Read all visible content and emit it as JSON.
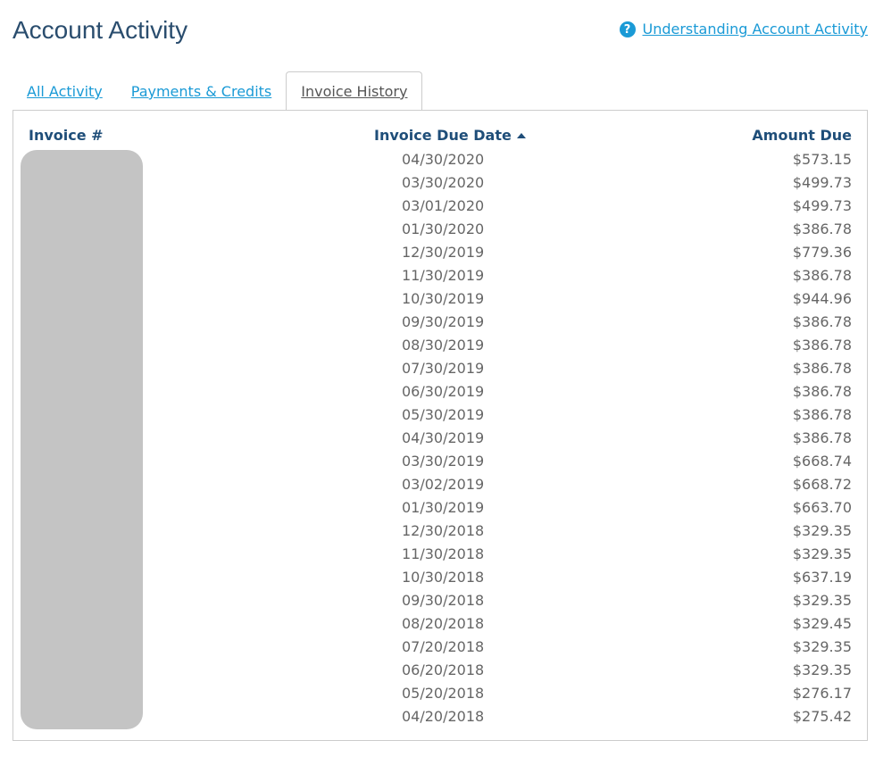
{
  "page": {
    "title": "Account Activity",
    "help_link": "Understanding Account Activity"
  },
  "tabs": [
    {
      "label": "All Activity",
      "active": false
    },
    {
      "label": "Payments & Credits",
      "active": false
    },
    {
      "label": "Invoice History",
      "active": true
    }
  ],
  "table": {
    "headers": {
      "invoice": "Invoice #",
      "due_date": "Invoice Due Date",
      "amount": "Amount Due"
    },
    "rows": [
      {
        "due_date": "04/30/2020",
        "amount": "$573.15"
      },
      {
        "due_date": "03/30/2020",
        "amount": "$499.73"
      },
      {
        "due_date": "03/01/2020",
        "amount": "$499.73"
      },
      {
        "due_date": "01/30/2020",
        "amount": "$386.78"
      },
      {
        "due_date": "12/30/2019",
        "amount": "$779.36"
      },
      {
        "due_date": "11/30/2019",
        "amount": "$386.78"
      },
      {
        "due_date": "10/30/2019",
        "amount": "$944.96"
      },
      {
        "due_date": "09/30/2019",
        "amount": "$386.78"
      },
      {
        "due_date": "08/30/2019",
        "amount": "$386.78"
      },
      {
        "due_date": "07/30/2019",
        "amount": "$386.78"
      },
      {
        "due_date": "06/30/2019",
        "amount": "$386.78"
      },
      {
        "due_date": "05/30/2019",
        "amount": "$386.78"
      },
      {
        "due_date": "04/30/2019",
        "amount": "$386.78"
      },
      {
        "due_date": "03/30/2019",
        "amount": "$668.74"
      },
      {
        "due_date": "03/02/2019",
        "amount": "$668.72"
      },
      {
        "due_date": "01/30/2019",
        "amount": "$663.70"
      },
      {
        "due_date": "12/30/2018",
        "amount": "$329.35"
      },
      {
        "due_date": "11/30/2018",
        "amount": "$329.35"
      },
      {
        "due_date": "10/30/2018",
        "amount": "$637.19"
      },
      {
        "due_date": "09/30/2018",
        "amount": "$329.35"
      },
      {
        "due_date": "08/20/2018",
        "amount": "$329.45"
      },
      {
        "due_date": "07/20/2018",
        "amount": "$329.35"
      },
      {
        "due_date": "06/20/2018",
        "amount": "$329.35"
      },
      {
        "due_date": "05/20/2018",
        "amount": "$276.17"
      },
      {
        "due_date": "04/20/2018",
        "amount": "$275.42"
      }
    ]
  },
  "colors": {
    "link": "#1a9ad6",
    "title": "#2a4d6e",
    "header": "#1f4e79",
    "body_text": "#666666",
    "redaction": "#c4c4c4"
  },
  "icons": {
    "help": "question-circle-icon",
    "sort": "sort-ascending-icon"
  }
}
